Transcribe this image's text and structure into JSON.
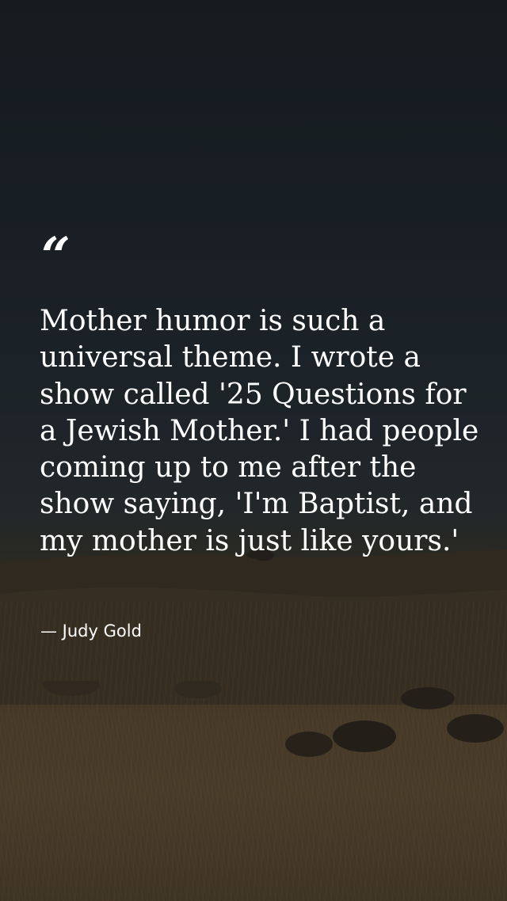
{
  "quote": {
    "mark": "“",
    "text": "Mother humor is such a universal theme. I wrote a show called '25 Questions for a Jewish Mother.' I had people coming up to me after the show saying, 'I'm Baptist, and my mother is just like yours.'",
    "author": "— Judy Gold"
  },
  "colors": {
    "text": "#ffffff",
    "sky": "#1e262c",
    "field": "#574832"
  }
}
